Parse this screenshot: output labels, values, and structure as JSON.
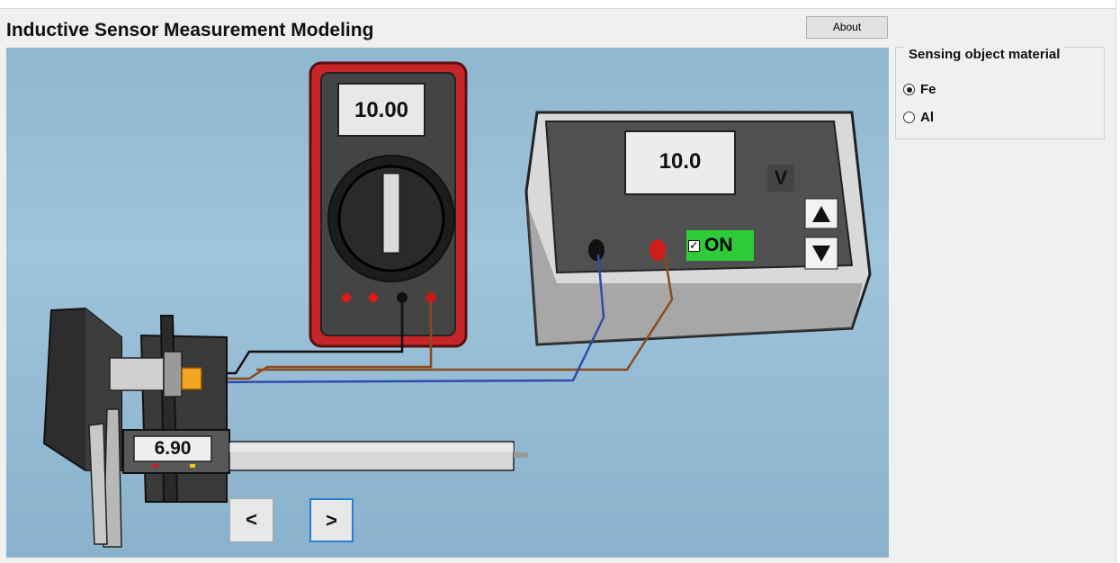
{
  "title": "Inductive Sensor Measurement Modeling",
  "about_label": "About",
  "material_group": {
    "title": "Sensing object material",
    "options": [
      {
        "label": "Fe",
        "selected": true
      },
      {
        "label": "Al",
        "selected": false
      }
    ]
  },
  "multimeter": {
    "reading": "10.00"
  },
  "power_supply": {
    "reading": "10.0",
    "unit": "V",
    "switch_label": "ON",
    "switch_checked": true
  },
  "caliper": {
    "reading": "6.90"
  },
  "nav": {
    "prev_label": "<",
    "next_label": ">"
  },
  "colors": {
    "accent": "#2a7fd4",
    "switch_on": "#2fcc3a",
    "multimeter_body": "#c9282a"
  }
}
